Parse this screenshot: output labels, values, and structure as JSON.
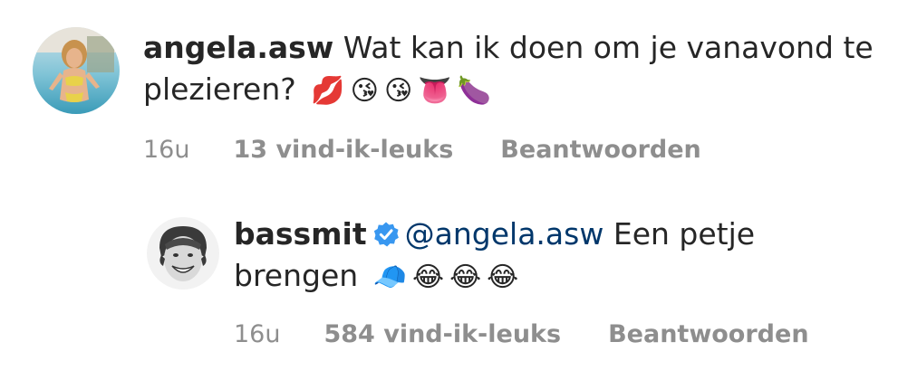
{
  "comments": [
    {
      "username": "angela.asw",
      "text": "Wat kan ik doen om je vanavond te plezieren?",
      "emojis": [
        "💋",
        "😘",
        "😘",
        "👅",
        "🍆"
      ],
      "time": "16u",
      "likes": "13 vind-ik-leuks",
      "reply_label": "Beantwoorden",
      "avatar_icon": "profile-photo-pool"
    },
    {
      "username": "bassmit",
      "verified": true,
      "mention": "@angela.asw",
      "text": "Een petje brengen",
      "emojis": [
        "🧢",
        "😂",
        "😂",
        "😂"
      ],
      "time": "16u",
      "likes": "584 vind-ik-leuks",
      "reply_label": "Beantwoorden",
      "avatar_icon": "profile-photo-smiling-man"
    }
  ],
  "colors": {
    "text": "#262626",
    "meta": "#8e8e8e",
    "mention": "#00376b",
    "verified": "#3897f0"
  }
}
